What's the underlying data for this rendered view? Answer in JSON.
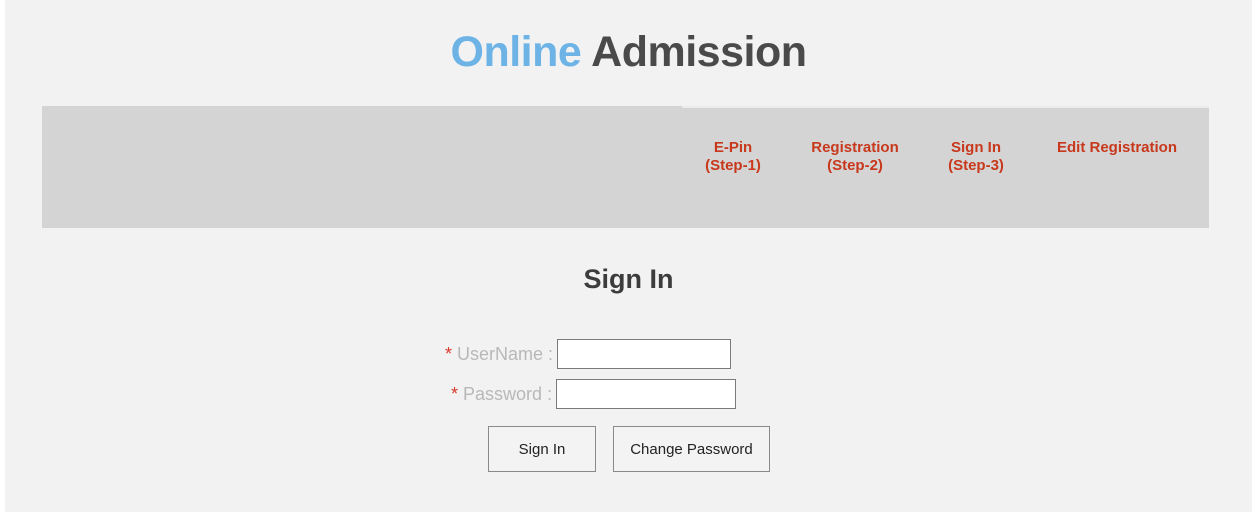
{
  "brand": {
    "part1": "Online",
    "part2": "Admission",
    "color1": "#6db3e6",
    "color2": "#4a4a4a"
  },
  "nav": {
    "link_color": "#c8381c",
    "items": [
      {
        "line1": "E-Pin",
        "line2": "(Step-1)"
      },
      {
        "line1": "Registration",
        "line2": "(Step-2)"
      },
      {
        "line1": "Sign In",
        "line2": "(Step-3)"
      },
      {
        "line1": "Edit Registration",
        "line2": ""
      }
    ]
  },
  "form": {
    "title": "Sign In",
    "required_marker": "*",
    "username": {
      "label": "UserName :",
      "value": ""
    },
    "password": {
      "label": "Password :",
      "value": ""
    },
    "sign_in_label": "Sign In",
    "change_password_label": "Change Password"
  }
}
